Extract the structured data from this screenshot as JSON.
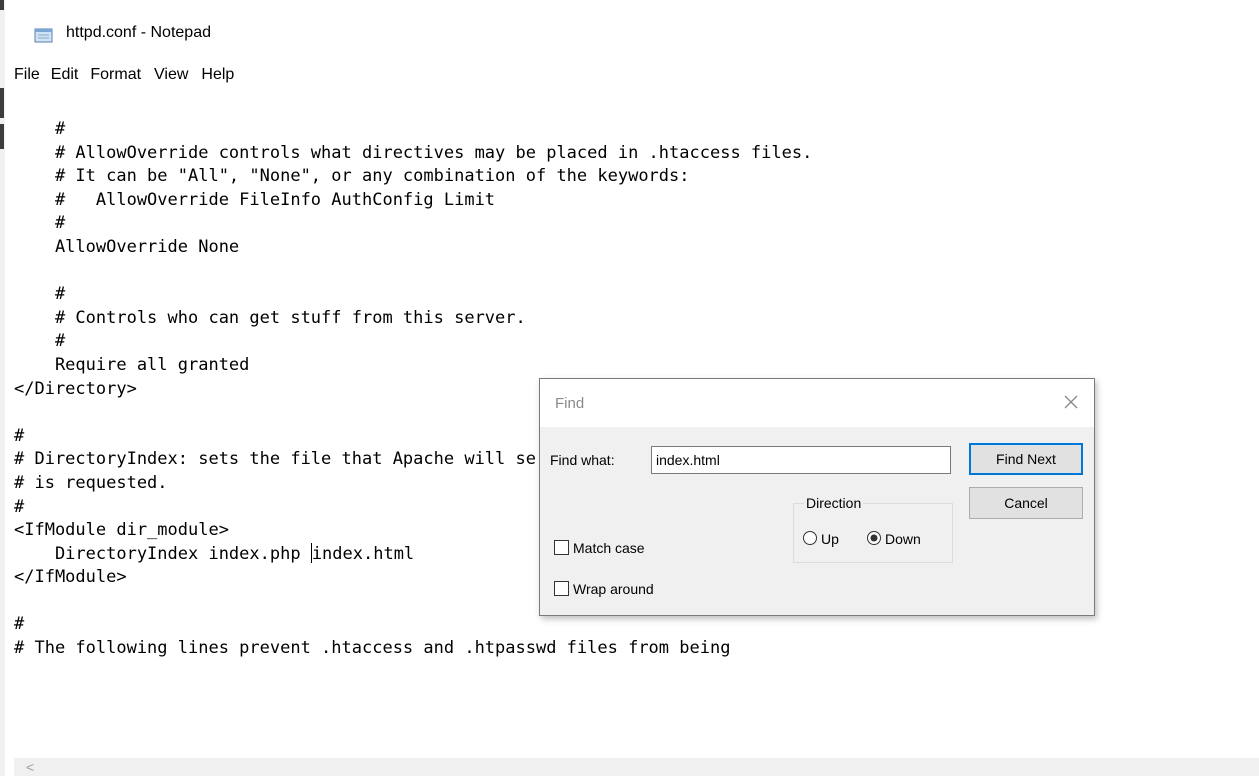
{
  "window": {
    "title": "httpd.conf - Notepad",
    "icon": "notepad-icon"
  },
  "menu": [
    "File",
    "Edit",
    "Format",
    "View",
    "Help"
  ],
  "editor": {
    "lines": [
      "    #",
      "    # AllowOverride controls what directives may be placed in .htaccess files.",
      "    # It can be \"All\", \"None\", or any combination of the keywords:",
      "    #   AllowOverride FileInfo AuthConfig Limit",
      "    #",
      "    AllowOverride None",
      "",
      "    #",
      "    # Controls who can get stuff from this server.",
      "    #",
      "    Require all granted",
      "</Directory>",
      "",
      "#",
      "# DirectoryIndex: sets the file that Apache will serve if a directory",
      "# is requested.",
      "#",
      "<IfModule dir_module>",
      "    DirectoryIndex index.php index.html",
      "</IfModule>",
      "",
      "#",
      "# The following lines prevent .htaccess and .htpasswd files from being"
    ],
    "caret_line": 18,
    "caret_before": "    DirectoryIndex index.php ",
    "caret_after": "index.html"
  },
  "find_dialog": {
    "title": "Find",
    "find_what_label": "Find what:",
    "find_what_value": "index.html",
    "find_next_label": "Find Next",
    "cancel_label": "Cancel",
    "direction_label": "Direction",
    "up_label": "Up",
    "down_label": "Down",
    "selected_direction": "Down",
    "match_case_label": "Match case",
    "match_case_checked": false,
    "wrap_around_label": "Wrap around",
    "wrap_around_checked": false
  },
  "colors": {
    "dialog_bg": "#f0f0f0",
    "accent": "#0078d7",
    "title_text": "#8a8a8a"
  }
}
